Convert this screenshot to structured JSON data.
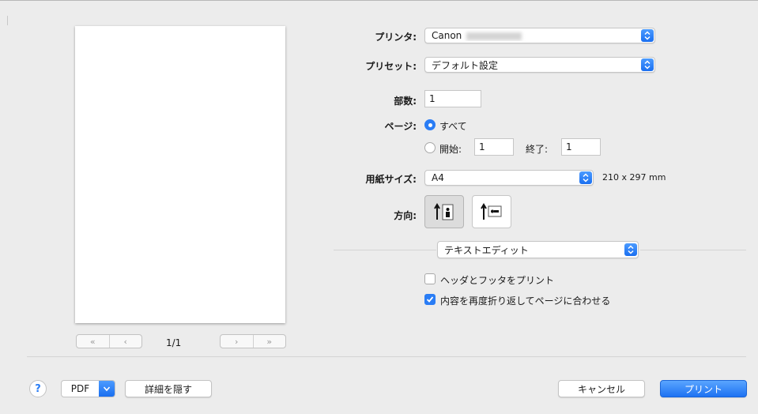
{
  "printer": {
    "label": "プリンタ:",
    "value": "Canon"
  },
  "preset": {
    "label": "プリセット:",
    "value": "デフォルト設定"
  },
  "copies": {
    "label": "部数:",
    "value": "1"
  },
  "pages": {
    "label": "ページ:",
    "all_label": "すべて",
    "from_label": "開始:",
    "from_value": "1",
    "to_label": "終了:",
    "to_value": "1"
  },
  "paper_size": {
    "label": "用紙サイズ:",
    "value": "A4",
    "dimensions": "210 x 297 mm"
  },
  "orientation": {
    "label": "方向:"
  },
  "app_section": {
    "value": "テキストエディット"
  },
  "options": {
    "header_footer": "ヘッダとフッタをプリント",
    "rewrap": "内容を再度折り返してページに合わせる"
  },
  "preview_nav": {
    "first": "«",
    "prev": "‹",
    "page_indicator": "1/1",
    "next": "›",
    "last": "»"
  },
  "footer": {
    "help": "?",
    "pdf": "PDF",
    "hide_details": "詳細を隠す",
    "cancel": "キャンセル",
    "print": "プリント"
  },
  "colors": {
    "accent": "#2a7df5",
    "background": "#ececec"
  }
}
